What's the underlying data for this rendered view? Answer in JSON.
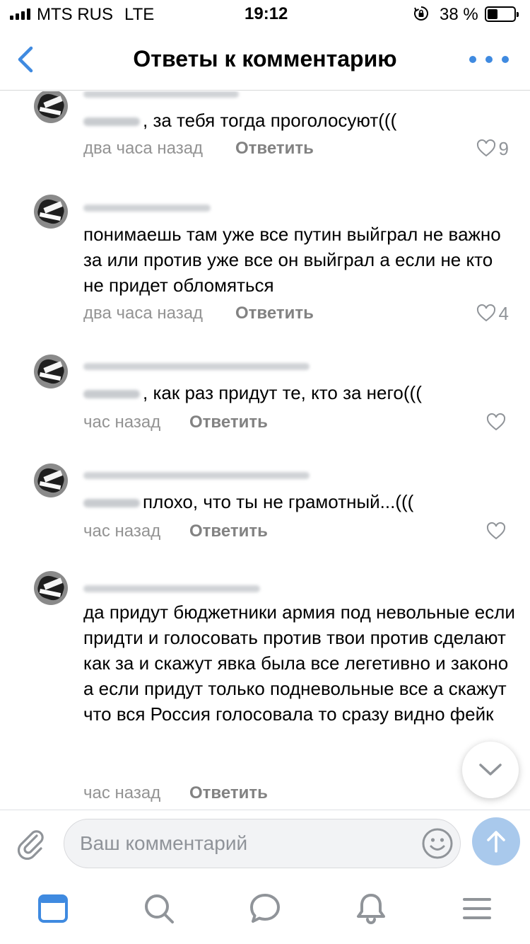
{
  "status_bar": {
    "carrier": "MTS RUS",
    "network": "LTE",
    "time": "19:12",
    "battery": "38 %",
    "battery_level": 0.38
  },
  "header": {
    "title": "Ответы к комментарию",
    "back_icon": "chevron-left-icon",
    "more_icon": "more-dots-icon"
  },
  "comments": [
    {
      "text": ", за тебя тогда проголосуют(((",
      "time": "два часа назад",
      "reply_label": "Ответить",
      "likes": "9"
    },
    {
      "text": "понимаешь там уже все путин выйграл не важно за или против уже все он выйграл а если не кто не придет обломяться",
      "time": "два часа назад",
      "reply_label": "Ответить",
      "likes": "4"
    },
    {
      "text": ", как раз придут те, кто за него(((",
      "time": "час назад",
      "reply_label": "Ответить",
      "likes": ""
    },
    {
      "text": "плохо, что ты не грамотный...(((",
      "time": "час назад",
      "reply_label": "Ответить",
      "likes": ""
    },
    {
      "text": "да придут бюджетники армия под невольные если придти и голосовать против твои против сделают как за и скажут явка была все легетивно и законо а если придут только подневольные все а скажут что вся Россия голосовала то сразу видно фейк",
      "time": "час назад",
      "reply_label": "Ответить",
      "likes": ""
    }
  ],
  "composer": {
    "placeholder": "Ваш комментарий",
    "value": ""
  },
  "colors": {
    "accent": "#3f8ae0",
    "send_button": "#a9c9ec",
    "secondary_text": "#939393",
    "icon_gray": "#909499"
  },
  "tab_bar": {
    "icons": [
      "news-icon",
      "search-icon",
      "messages-icon",
      "notifications-icon",
      "menu-icon"
    ]
  }
}
